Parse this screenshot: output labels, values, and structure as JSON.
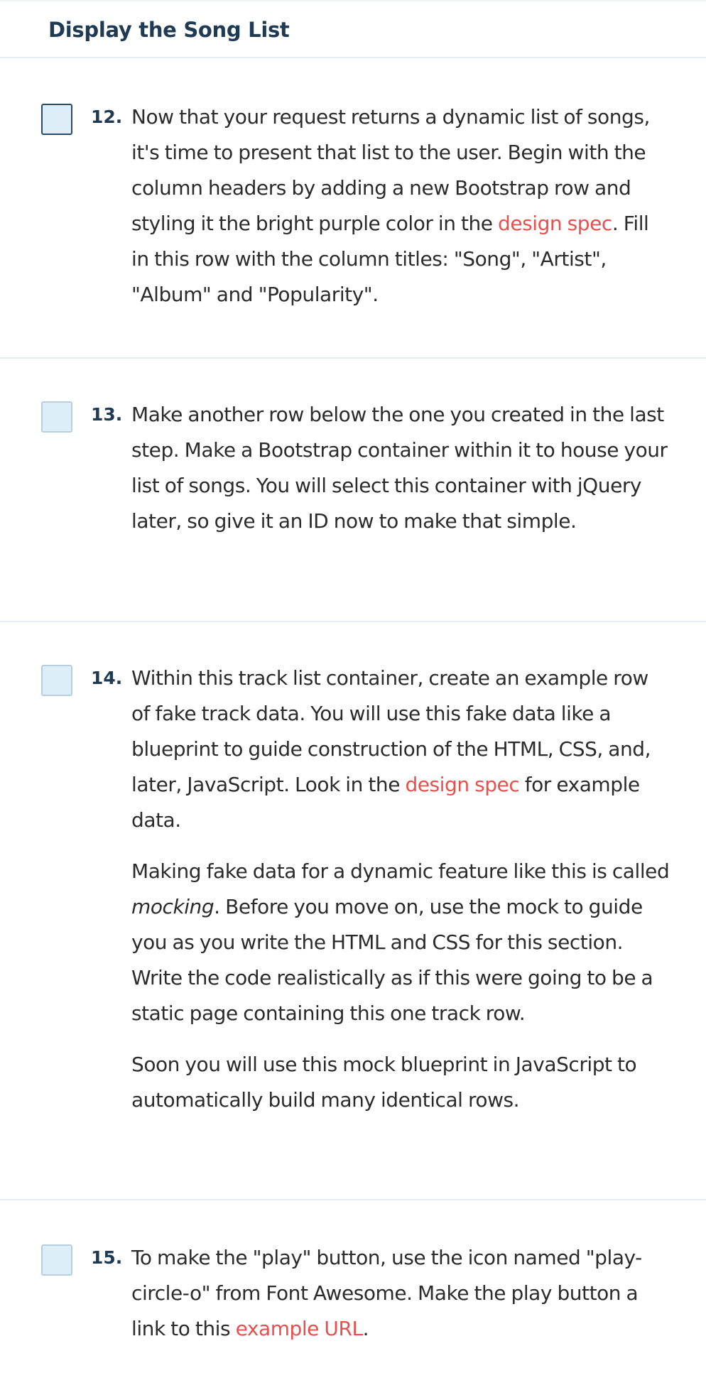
{
  "section": {
    "title": "Display the Song List"
  },
  "colors": {
    "heading": "#1f3a53",
    "body_text": "#2b2b2b",
    "link": "#e8504d",
    "checkbox_fill": "#ddeef8",
    "divider": "#e5eef3"
  },
  "steps": [
    {
      "number": "12.",
      "paragraphs": [
        {
          "before": "Now that your request returns a dynamic list of songs, it's time to present that list to the user. Begin with the column headers by adding a new Bootstrap row and styling it the bright purple color in the ",
          "link": "design spec",
          "after": ". Fill in this row with the column titles: \"Song\", \"Artist\", \"Album\" and \"Popularity\"."
        }
      ]
    },
    {
      "number": "13.",
      "paragraphs": [
        {
          "text": "Make another row below the one you created in the last step. Make a Bootstrap container within it to house your list of songs. You will select this container with jQuery later, so give it an ID now to make that simple."
        }
      ]
    },
    {
      "number": "14.",
      "paragraphs": [
        {
          "before": "Within this track list container, create an example row of fake track data. You will use this fake data like a blueprint to guide construction of the HTML, CSS, and, later, JavaScript. Look in the ",
          "link": "design spec",
          "after": " for example data."
        },
        {
          "before": "Making fake data for a dynamic feature like this is called ",
          "italic": "mocking",
          "after": ". Before you move on, use the mock to guide you as you write the HTML and CSS for this section. Write the code realistically as if this were going to be a static page containing this one track row."
        },
        {
          "text": "Soon you will use this mock blueprint in JavaScript to automatically build many identical rows."
        }
      ]
    },
    {
      "number": "15.",
      "paragraphs": [
        {
          "before": "To make the \"play\" button, use the icon named \"play-circle-o\" from Font Awesome. Make the play button a link to this ",
          "link": "example URL",
          "after": "."
        }
      ]
    }
  ]
}
